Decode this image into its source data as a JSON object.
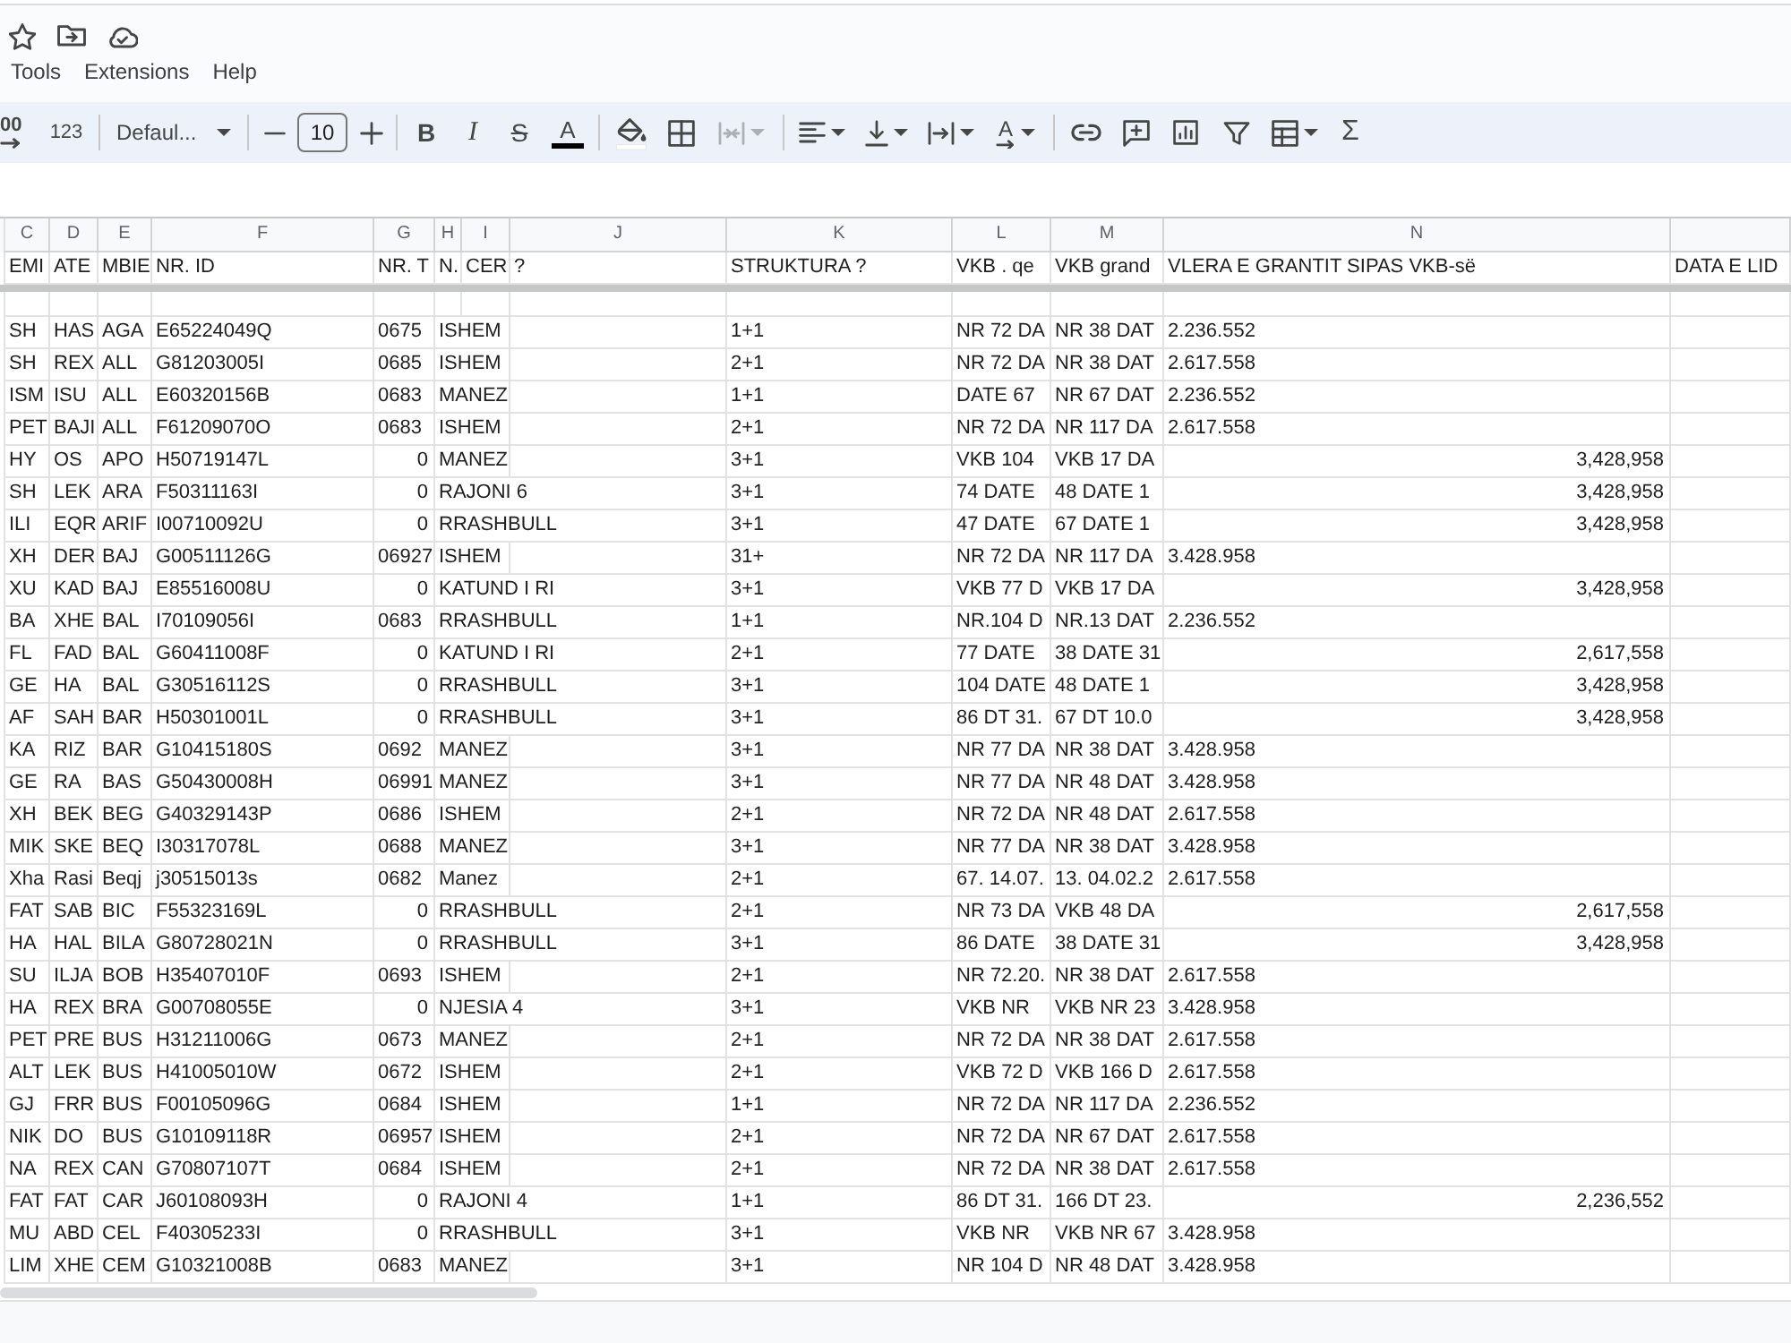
{
  "menu": [
    "Tools",
    "Extensions",
    "Help"
  ],
  "toolbar": [
    {
      "items": [
        {
          "kind": "decimal",
          "label": "00",
          "disabled": false
        },
        {
          "kind": "number-format",
          "label": "123",
          "disabled": false
        }
      ]
    },
    {
      "items": [
        {
          "kind": "font",
          "label": "Defaul...",
          "disabled": false
        }
      ]
    },
    {
      "items": [
        {
          "kind": "decrease",
          "disabled": false
        },
        {
          "kind": "font-size",
          "label": "10",
          "disabled": false
        },
        {
          "kind": "increase",
          "disabled": false
        }
      ]
    },
    {
      "items": [
        {
          "kind": "bold",
          "label": "B",
          "disabled": false
        },
        {
          "kind": "italic",
          "label": "I",
          "disabled": false
        },
        {
          "kind": "strikethrough",
          "label": "S",
          "disabled": false
        },
        {
          "kind": "text-color",
          "label": "A",
          "disabled": false
        }
      ]
    },
    {
      "items": [
        {
          "kind": "fill-color",
          "disabled": false
        },
        {
          "kind": "borders",
          "disabled": false
        },
        {
          "kind": "merge",
          "disabled": true
        }
      ]
    },
    {
      "items": [
        {
          "kind": "align",
          "disabled": false
        },
        {
          "kind": "valign",
          "disabled": false
        },
        {
          "kind": "wrap",
          "disabled": false
        },
        {
          "kind": "rotate",
          "label": "A",
          "disabled": false
        }
      ]
    },
    {
      "items": [
        {
          "kind": "link",
          "disabled": false
        },
        {
          "kind": "comment",
          "disabled": false
        },
        {
          "kind": "chart",
          "disabled": false
        },
        {
          "kind": "filter",
          "disabled": false
        },
        {
          "kind": "table",
          "disabled": false
        },
        {
          "kind": "functions",
          "label": "Σ",
          "disabled": false
        }
      ]
    }
  ],
  "sheet": {
    "columns": [
      {
        "letter": "C",
        "header": "EMI"
      },
      {
        "letter": "D",
        "header": "ATE"
      },
      {
        "letter": "E",
        "header": "MBIE"
      },
      {
        "letter": "F",
        "header": "NR. ID"
      },
      {
        "letter": "G",
        "header": "NR. T"
      },
      {
        "letter": "H",
        "header": "N."
      },
      {
        "letter": "I",
        "header": "CER"
      },
      {
        "letter": "J",
        "header": "?"
      },
      {
        "letter": "K",
        "header": "STRUKTURA ?"
      },
      {
        "letter": "L",
        "header": "VKB . qe"
      },
      {
        "letter": "M",
        "header": "VKB grand"
      },
      {
        "letter": "N",
        "header": "VLERA E GRANTIT SIPAS VKB-së"
      },
      {
        "header": "DATA E LID"
      }
    ],
    "rows": [
      {
        "cells": [
          "SH",
          "HAS",
          "AGA",
          "E65224049Q",
          "0675",
          "ISHEM",
          "",
          "",
          "1+1",
          "NR 72 DA",
          "NR 38 DAT",
          "2.236.552"
        ],
        "g_is_number": false,
        "n_is_number": false
      },
      {
        "cells": [
          "SH",
          "REX",
          "ALL",
          "G81203005I",
          "0685",
          "ISHEM",
          "",
          "",
          "2+1",
          "NR 72 DA",
          "NR 38 DAT",
          "2.617.558"
        ],
        "g_is_number": false,
        "n_is_number": false
      },
      {
        "cells": [
          "ISM",
          "ISU",
          "ALL",
          "E60320156B",
          "0683",
          "MANEZ",
          "",
          "",
          "1+1",
          "DATE 67",
          "NR 67 DAT",
          "2.236.552"
        ],
        "g_is_number": false,
        "n_is_number": false
      },
      {
        "cells": [
          "PET",
          "BAJI",
          "ALL",
          "F61209070O",
          "0683",
          "ISHEM",
          "",
          "",
          "2+1",
          "NR 72 DA",
          "NR 117 DA",
          "2.617.558"
        ],
        "g_is_number": false,
        "n_is_number": false
      },
      {
        "cells": [
          "HY",
          "OS",
          "APO",
          "H50719147L",
          "0",
          "MANEZ",
          "",
          "",
          "3+1",
          "VKB 104",
          "VKB 17 DA",
          "3,428,958"
        ],
        "g_is_number": true,
        "n_is_number": true
      },
      {
        "cells": [
          "SH",
          "LEK",
          "ARA",
          "F50311163I",
          "0",
          "RAJONI 6",
          "",
          "",
          "3+1",
          "74 DATE",
          "48 DATE 1",
          "3,428,958"
        ],
        "g_is_number": true,
        "n_is_number": true
      },
      {
        "cells": [
          "ILI",
          "EQR",
          "ARIF",
          "I00710092U",
          "0",
          "RRASHBULL",
          "",
          "",
          "3+1",
          "47 DATE",
          "67 DATE 1",
          "3,428,958"
        ],
        "g_is_number": true,
        "n_is_number": true
      },
      {
        "cells": [
          "XH",
          "DER",
          "BAJ",
          "G00511126G",
          "06927",
          "ISHEM",
          "",
          "",
          "31+",
          "NR 72 DA",
          "NR 117 DA",
          "3.428.958"
        ],
        "g_is_number": false,
        "n_is_number": false
      },
      {
        "cells": [
          "XU",
          "KAD",
          "BAJ",
          "E85516008U",
          "0",
          "KATUND I RI",
          "",
          "",
          "3+1",
          "VKB 77 D",
          "VKB 17 DA",
          "3,428,958"
        ],
        "g_is_number": true,
        "n_is_number": true
      },
      {
        "cells": [
          "BA",
          "XHE",
          "BAL",
          "I70109056I",
          "0683",
          "RRASHBULL",
          "",
          "",
          "1+1",
          "NR.104 D",
          "NR.13 DAT",
          "2.236.552"
        ],
        "g_is_number": false,
        "n_is_number": false
      },
      {
        "cells": [
          "FL",
          "FAD",
          "BAL",
          "G60411008F",
          "0",
          "KATUND I RI",
          "",
          "",
          "2+1",
          "77 DATE",
          "38 DATE 31",
          "2,617,558"
        ],
        "g_is_number": true,
        "n_is_number": true
      },
      {
        "cells": [
          "GE",
          "HA",
          "BAL",
          "G30516112S",
          "0",
          "RRASHBULL",
          "",
          "",
          "3+1",
          "104 DATE",
          "48 DATE 1",
          "3,428,958"
        ],
        "g_is_number": true,
        "n_is_number": true
      },
      {
        "cells": [
          "AF",
          "SAH",
          "BAR",
          "H50301001L",
          "0",
          "RRASHBULL",
          "",
          "",
          "3+1",
          "86 DT 31.",
          "67 DT 10.0",
          "3,428,958"
        ],
        "g_is_number": true,
        "n_is_number": true
      },
      {
        "cells": [
          "KA",
          "RIZ",
          "BAR",
          "G10415180S",
          "0692",
          "MANEZ",
          "",
          "",
          "3+1",
          "NR 77 DA",
          "NR 38 DAT",
          "3.428.958"
        ],
        "g_is_number": false,
        "n_is_number": false
      },
      {
        "cells": [
          "GE",
          "RA",
          "BAS",
          "G50430008H",
          "06991",
          "MANEZ",
          "",
          "",
          "3+1",
          "NR 77 DA",
          "NR 48 DAT",
          "3.428.958"
        ],
        "g_is_number": false,
        "n_is_number": false
      },
      {
        "cells": [
          "XH",
          "BEK",
          "BEG",
          "G40329143P",
          "0686",
          "ISHEM",
          "",
          "",
          "2+1",
          "NR 72 DA",
          "NR 48 DAT",
          "2.617.558"
        ],
        "g_is_number": false,
        "n_is_number": false
      },
      {
        "cells": [
          "MIK",
          "SKE",
          "BEQ",
          "I30317078L",
          "0688",
          "MANEZ",
          "",
          "",
          "3+1",
          "NR 77 DA",
          "NR 38 DAT",
          "3.428.958"
        ],
        "g_is_number": false,
        "n_is_number": false
      },
      {
        "cells": [
          "Xha",
          "Rasi",
          "Beqj",
          "j30515013s",
          "0682",
          "Manez",
          "",
          "",
          "2+1",
          "67. 14.07.",
          "13. 04.02.2",
          "2.617.558"
        ],
        "g_is_number": false,
        "n_is_number": false
      },
      {
        "cells": [
          "FAT",
          "SAB",
          "BIC",
          "F55323169L",
          "0",
          "RRASHBULL",
          "",
          "",
          "2+1",
          "NR 73 DA",
          "VKB 48 DA",
          "2,617,558"
        ],
        "g_is_number": true,
        "n_is_number": true
      },
      {
        "cells": [
          "HA",
          "HAL",
          "BILA",
          "G80728021N",
          "0",
          "RRASHBULL",
          "",
          "",
          "3+1",
          "86 DATE",
          "38 DATE 31",
          "3,428,958"
        ],
        "g_is_number": true,
        "n_is_number": true
      },
      {
        "cells": [
          "SU",
          "ILJA",
          "BOB",
          "H35407010F",
          "0693",
          "ISHEM",
          "",
          "",
          "2+1",
          "NR 72.20.",
          "NR 38 DAT",
          "2.617.558"
        ],
        "g_is_number": false,
        "n_is_number": false
      },
      {
        "cells": [
          "HA",
          "REX",
          "BRA",
          "G00708055E",
          "0",
          "NJESIA 4",
          "",
          "",
          "3+1",
          "VKB NR",
          "VKB NR 23",
          "3.428.958"
        ],
        "g_is_number": true,
        "n_is_number": false
      },
      {
        "cells": [
          "PET",
          "PRE",
          "BUS",
          "H31211006G",
          "0673",
          "MANEZ",
          "",
          "",
          "2+1",
          "NR 72 DA",
          "NR 38 DAT",
          "2.617.558"
        ],
        "g_is_number": false,
        "n_is_number": false
      },
      {
        "cells": [
          "ALT",
          "LEK",
          "BUS",
          "H41005010W",
          "0672",
          "ISHEM",
          "",
          "",
          "2+1",
          "VKB 72 D",
          "VKB 166 D",
          "2.617.558"
        ],
        "g_is_number": false,
        "n_is_number": false
      },
      {
        "cells": [
          "GJ",
          "FRR",
          "BUS",
          "F00105096G",
          "0684",
          "ISHEM",
          "",
          "",
          "1+1",
          "NR 72 DA",
          "NR 117 DA",
          "2.236.552"
        ],
        "g_is_number": false,
        "n_is_number": false
      },
      {
        "cells": [
          "NIK",
          "DO",
          "BUS",
          "G10109118R",
          "06957",
          "ISHEM",
          "",
          "",
          "2+1",
          "NR 72 DA",
          "NR 67 DAT",
          "2.617.558"
        ],
        "g_is_number": false,
        "n_is_number": false
      },
      {
        "cells": [
          "NA",
          "REX",
          "CAN",
          "G70807107T",
          "0684",
          "ISHEM",
          "",
          "",
          "2+1",
          "NR 72 DA",
          "NR 38 DAT",
          "2.617.558"
        ],
        "g_is_number": false,
        "n_is_number": false
      },
      {
        "cells": [
          "FAT",
          "FAT",
          "CAR",
          "J60108093H",
          "0",
          "RAJONI 4",
          "",
          "",
          "1+1",
          "86 DT 31.",
          "166 DT 23.",
          "2,236,552"
        ],
        "g_is_number": true,
        "n_is_number": true
      },
      {
        "cells": [
          "MU",
          "ABD",
          "CEL",
          "F40305233I",
          "0",
          "RRASHBULL",
          "",
          "",
          "3+1",
          "VKB NR",
          "VKB NR 67",
          "3.428.958"
        ],
        "g_is_number": true,
        "n_is_number": false
      },
      {
        "cells": [
          "LIM",
          "XHE",
          "CEM",
          "G10321008B",
          "0683",
          "MANEZ",
          "",
          "",
          "3+1",
          "NR 104 D",
          "NR 48 DAT",
          "3.428.958"
        ],
        "g_is_number": false,
        "n_is_number": false
      }
    ]
  }
}
